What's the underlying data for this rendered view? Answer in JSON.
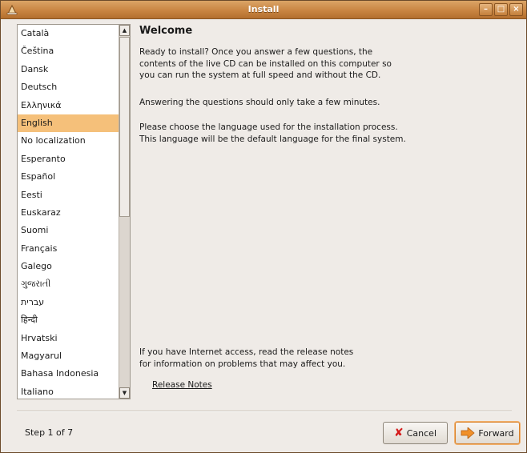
{
  "window": {
    "title": "Install"
  },
  "languages": [
    "Català",
    "Čeština",
    "Dansk",
    "Deutsch",
    "Ελληνικά",
    "English",
    "No localization",
    "Esperanto",
    "Español",
    "Eesti",
    "Euskaraz",
    "Suomi",
    "Français",
    "Galego",
    "ગુજરાતી",
    "עברית",
    "हिन्दी",
    "Hrvatski",
    "Magyarul",
    "Bahasa Indonesia",
    "Italiano"
  ],
  "selected_language": "English",
  "main": {
    "heading": "Welcome",
    "intro": [
      "Ready to install? Once you answer a few questions, the",
      "contents of the live CD can be installed on this computer so",
      "you can run the system at full speed and without the CD."
    ],
    "time_note": "Answering the questions should only take a few minutes.",
    "language_note": [
      "Please choose the language used for the installation process.",
      "This language will be the default language for the final system."
    ],
    "internet_note": [
      "If you have Internet access, read the release notes",
      "for information on problems that may affect you."
    ],
    "release_notes_label": "Release Notes"
  },
  "footer": {
    "step": "Step 1 of 7",
    "cancel_label": "Cancel",
    "forward_label": "Forward"
  },
  "colors": {
    "titlebar": "#c98542",
    "selection": "#f5c07a",
    "forward_border": "#d9822b"
  }
}
